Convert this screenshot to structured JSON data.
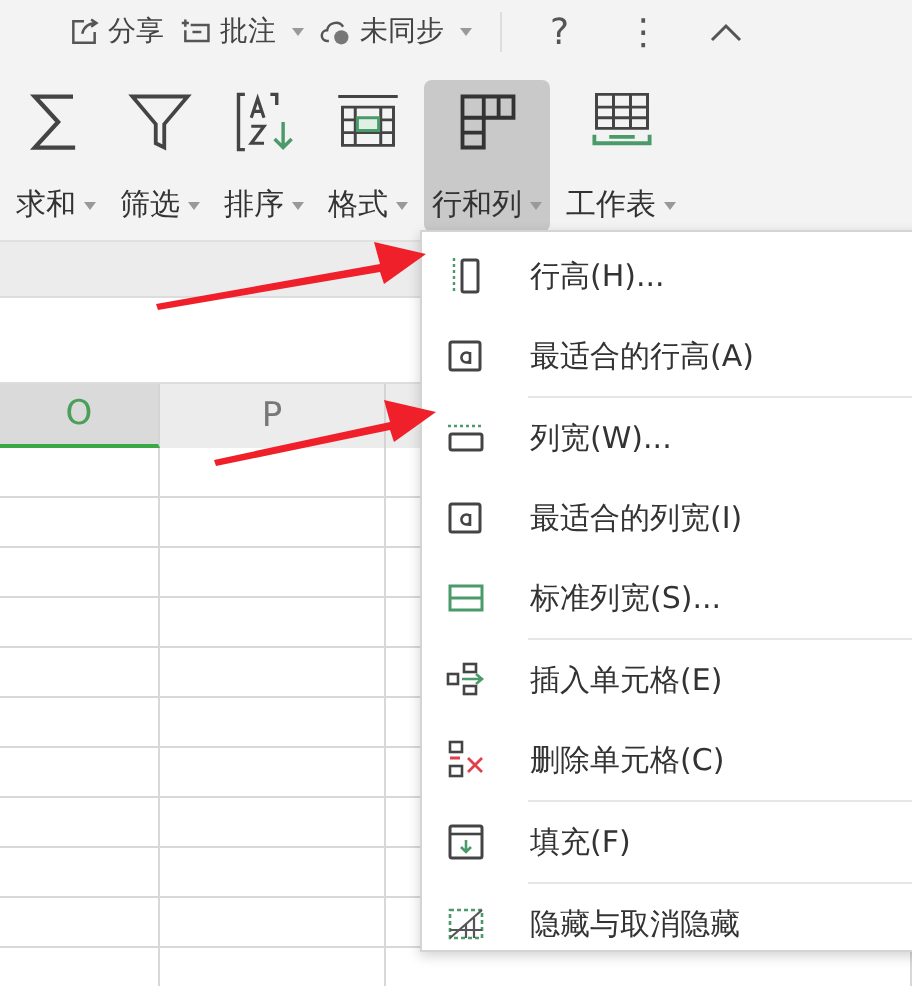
{
  "top_bar": {
    "items": [
      {
        "label": "分享",
        "kind": "share",
        "caret": false
      },
      {
        "label": "批注",
        "kind": "comment",
        "caret": true
      },
      {
        "label": "未同步",
        "kind": "cloud",
        "caret": true
      }
    ],
    "help": "?",
    "more": "⋮"
  },
  "ribbon": [
    {
      "label": "求和",
      "kind": "sum",
      "selected": false
    },
    {
      "label": "筛选",
      "kind": "filter",
      "selected": false
    },
    {
      "label": "排序",
      "kind": "sort",
      "selected": false
    },
    {
      "label": "格式",
      "kind": "format",
      "selected": false
    },
    {
      "label": "行和列",
      "kind": "rowcol",
      "selected": true
    },
    {
      "label": "工作表",
      "kind": "sheet",
      "selected": false
    }
  ],
  "columns": [
    {
      "label": "O",
      "selected": true
    },
    {
      "label": "P",
      "selected": false
    }
  ],
  "menu": {
    "groups": [
      [
        {
          "label": "行高(H)...",
          "kind": "row-height"
        },
        {
          "label": "最适合的行高(A)",
          "kind": "autofit"
        }
      ],
      [
        {
          "label": "列宽(W)...",
          "kind": "col-width"
        },
        {
          "label": "最适合的列宽(I)",
          "kind": "autofit"
        },
        {
          "label": "标准列宽(S)...",
          "kind": "std-width"
        }
      ],
      [
        {
          "label": "插入单元格(E)",
          "kind": "insert"
        },
        {
          "label": "删除单元格(C)",
          "kind": "delete"
        }
      ],
      [
        {
          "label": "填充(F)",
          "kind": "fill"
        }
      ],
      [
        {
          "label": "隐藏与取消隐藏",
          "kind": "hide"
        }
      ]
    ]
  }
}
